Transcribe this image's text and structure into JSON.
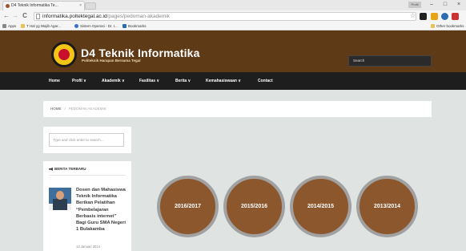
{
  "browser": {
    "tab_title": "D4 Teknik Informatika Te...",
    "tab_close": "×",
    "profile_badge": "Profil",
    "window_controls": [
      "–",
      "□",
      "×"
    ],
    "address_host": "informatika.poltektegal.ac.id",
    "address_path": "/pages/pedoman-akademik",
    "nav_icons": [
      "back-arrow-icon",
      "forward-arrow-icon",
      "reload-icon"
    ],
    "bookmarks": [
      "Apps",
      "T Hal yg Wajib Agar...",
      "Sistem Operasi - Dr. I...",
      "Bookmarks"
    ],
    "other_bookmarks": "Other bookmarks"
  },
  "site": {
    "title": "D4 Teknik Informatika",
    "subtitle": "Politeknik Harapan Bersama Tegal",
    "search_placeholder": "Search",
    "brand_color": "#5e3a16"
  },
  "nav": {
    "items": [
      {
        "label": "Home"
      },
      {
        "label": "Profil ∨"
      },
      {
        "label": "Akademik ∨"
      },
      {
        "label": "Fasilitas ∨"
      },
      {
        "label": "Berita ∨"
      },
      {
        "label": "Kemahasiswaan ∨"
      },
      {
        "label": "Contact"
      }
    ]
  },
  "breadcrumb": {
    "home": "HOME",
    "separator": "/",
    "current": "PEDOMAN AKADEMIK"
  },
  "sidebar": {
    "search_placeholder": "Type and click enter to search...",
    "news_heading": "BERITA TERBARU",
    "news_item": {
      "title": "Dosen dan Mahasiswa Teknik Informatika Berikan Pelatihan “Pembelajaran Berbasis internet” Bagi Guru SMA Negeri 1 Bulakamba",
      "date": "12 Januari 2014"
    }
  },
  "years": [
    "2016/2017",
    "2015/2016",
    "2014/2015",
    "2013/2014"
  ],
  "colors": {
    "year_circle": "#8c572d",
    "year_ring": "#a1a1a1",
    "nav_bg": "#1e1e1e",
    "page_bg": "#dfe3e2"
  }
}
